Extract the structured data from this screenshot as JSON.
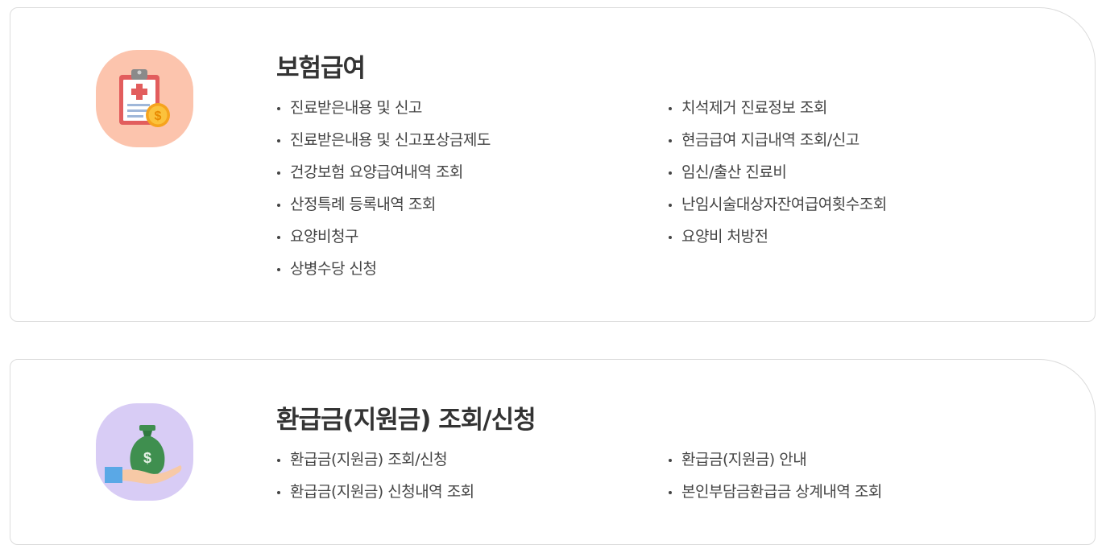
{
  "colors": {
    "insurance_icon_bg": "#fcc4ad",
    "refund_icon_bg": "#d8ccf5",
    "card_border": "#dcdcdc",
    "title_text": "#333333",
    "item_text": "#444444"
  },
  "insurance": {
    "icon": "clipboard-coin-icon",
    "title": "보험급여",
    "left_items": [
      "진료받은내용 및 신고",
      "진료받은내용 및 신고포상금제도",
      "건강보험 요양급여내역 조회",
      "산정특례 등록내역 조회",
      "요양비청구",
      "상병수당 신청"
    ],
    "right_items": [
      "치석제거 진료정보 조회",
      "현금급여 지급내역 조회/신고",
      "임신/출산 진료비",
      "난임시술대상자잔여급여횟수조회",
      "요양비 처방전"
    ]
  },
  "refund": {
    "icon": "money-bag-hand-icon",
    "title": "환급금(지원금) 조회/신청",
    "left_items": [
      "환급금(지원금) 조회/신청",
      "환급금(지원금) 신청내역 조회"
    ],
    "right_items": [
      "환급금(지원금) 안내",
      "본인부담금환급금 상계내역 조회"
    ]
  }
}
